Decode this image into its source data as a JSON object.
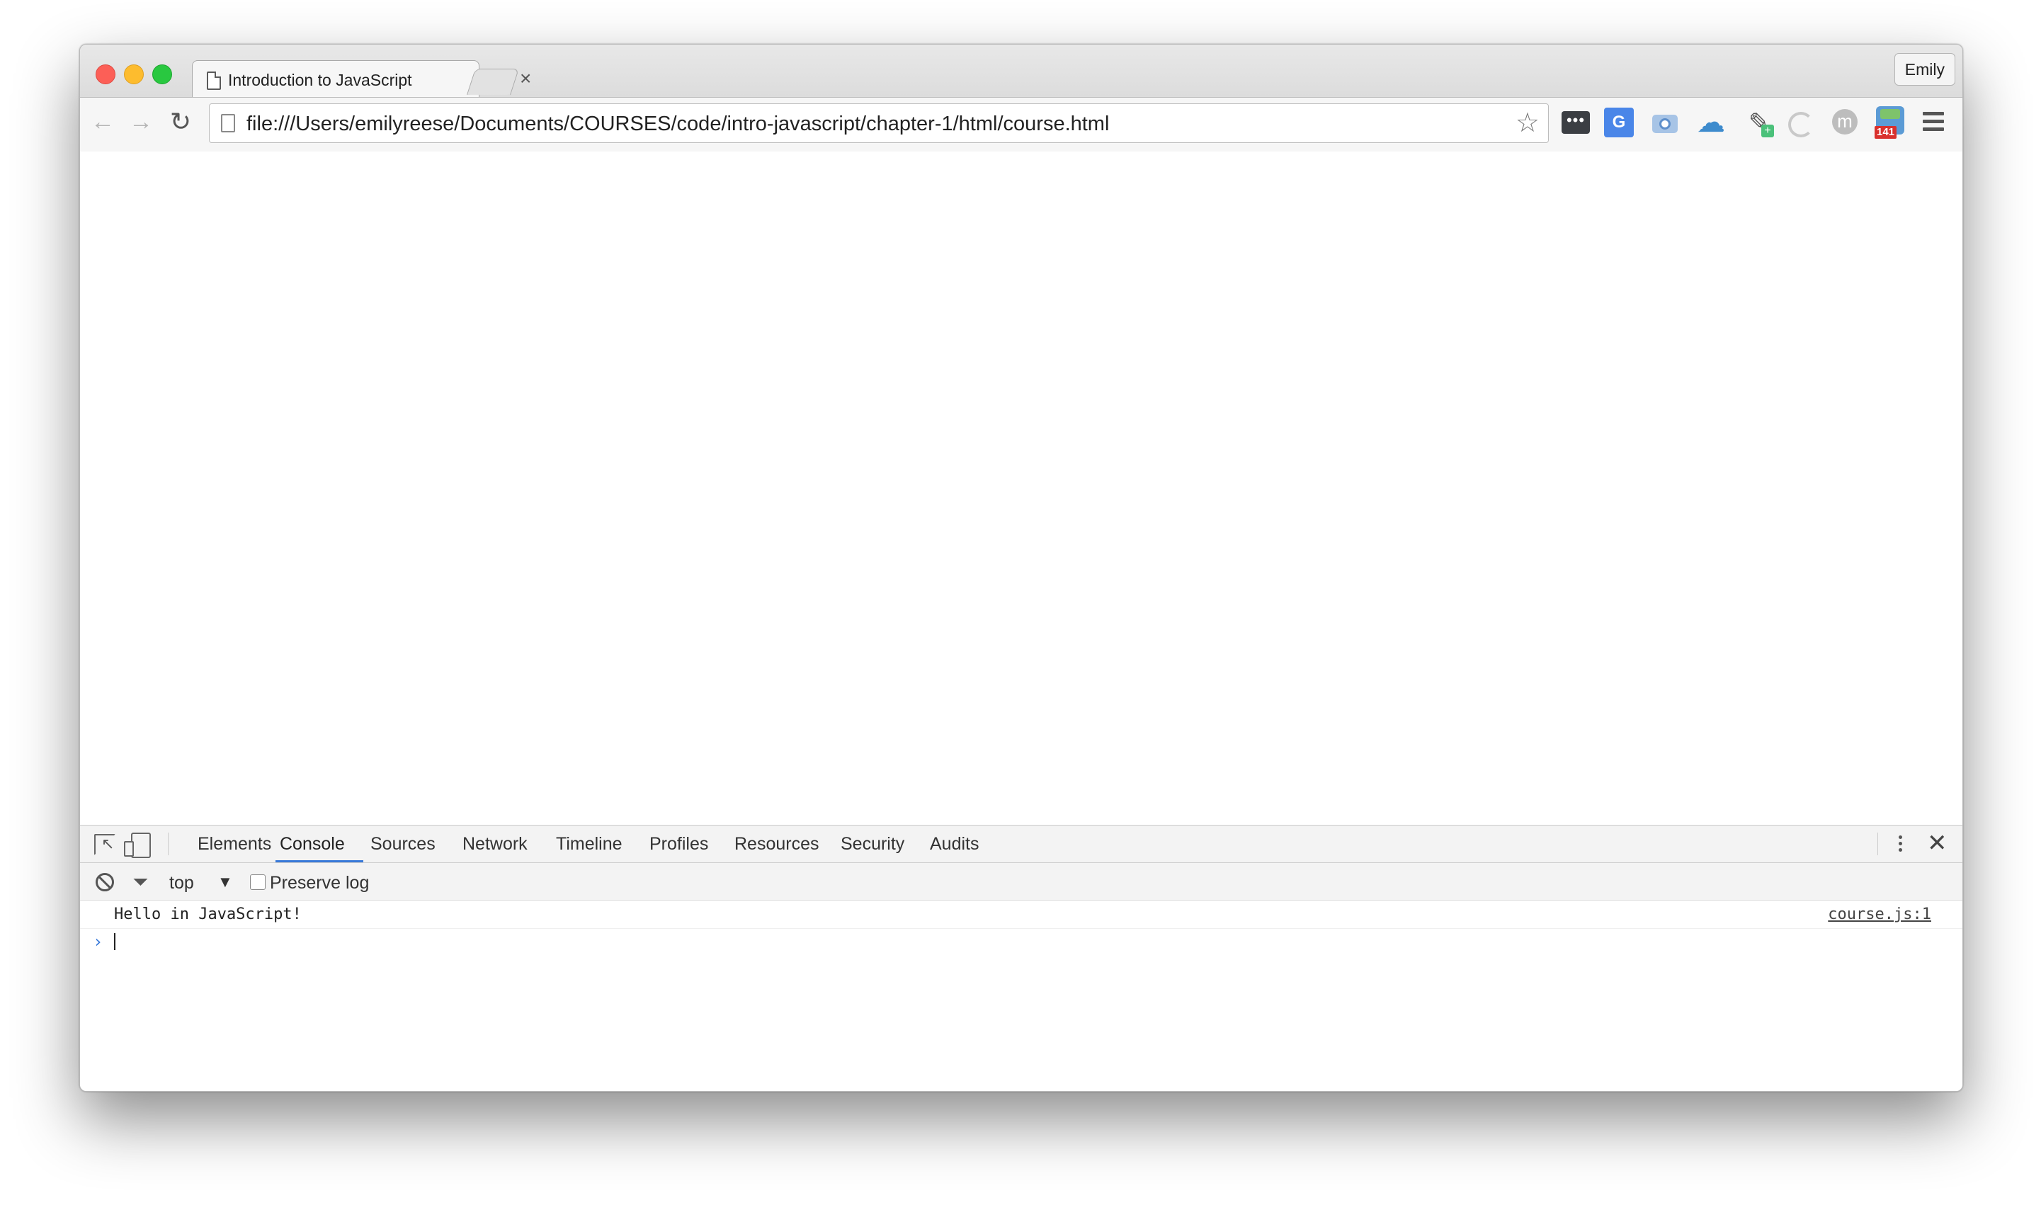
{
  "browser": {
    "tab": {
      "title": "Introduction to JavaScript",
      "close_glyph": "×"
    },
    "profile_name": "Emily",
    "toolbar": {
      "back_glyph": "←",
      "forward_glyph": "→",
      "reload_glyph": "↻",
      "url": "file:///Users/emilyreese/Documents/COURSES/code/intro-javascript/chapter-1/html/course.html",
      "star_glyph": "☆"
    },
    "extensions": [
      {
        "name": "lastpass-icon",
        "text": "•••"
      },
      {
        "name": "google-translate-icon",
        "text": "G"
      },
      {
        "name": "screenshot-camera-icon"
      },
      {
        "name": "cloud-icon",
        "text": "☁"
      },
      {
        "name": "color-picker-icon",
        "text": "✎"
      },
      {
        "name": "loading-ring-icon"
      },
      {
        "name": "m-extension-icon",
        "text": "m"
      },
      {
        "name": "notification-badge-icon",
        "badge": "141"
      }
    ]
  },
  "devtools": {
    "tabs": [
      "Elements",
      "Console",
      "Sources",
      "Network",
      "Timeline",
      "Profiles",
      "Resources",
      "Security",
      "Audits"
    ],
    "active_tab": "Console",
    "close_glyph": "✕",
    "console_toolbar": {
      "context": "top",
      "context_arrow": "▼",
      "preserve_log_label": "Preserve log",
      "preserve_log_checked": false
    },
    "messages": [
      {
        "text": "Hello in JavaScript!",
        "source": "course.js:1"
      }
    ],
    "prompt_glyph": "›"
  },
  "colors": {
    "accent": "#3879d9",
    "close_red": "#fc5f57",
    "minimize_yellow": "#fdbc2e",
    "zoom_green": "#29c840"
  }
}
